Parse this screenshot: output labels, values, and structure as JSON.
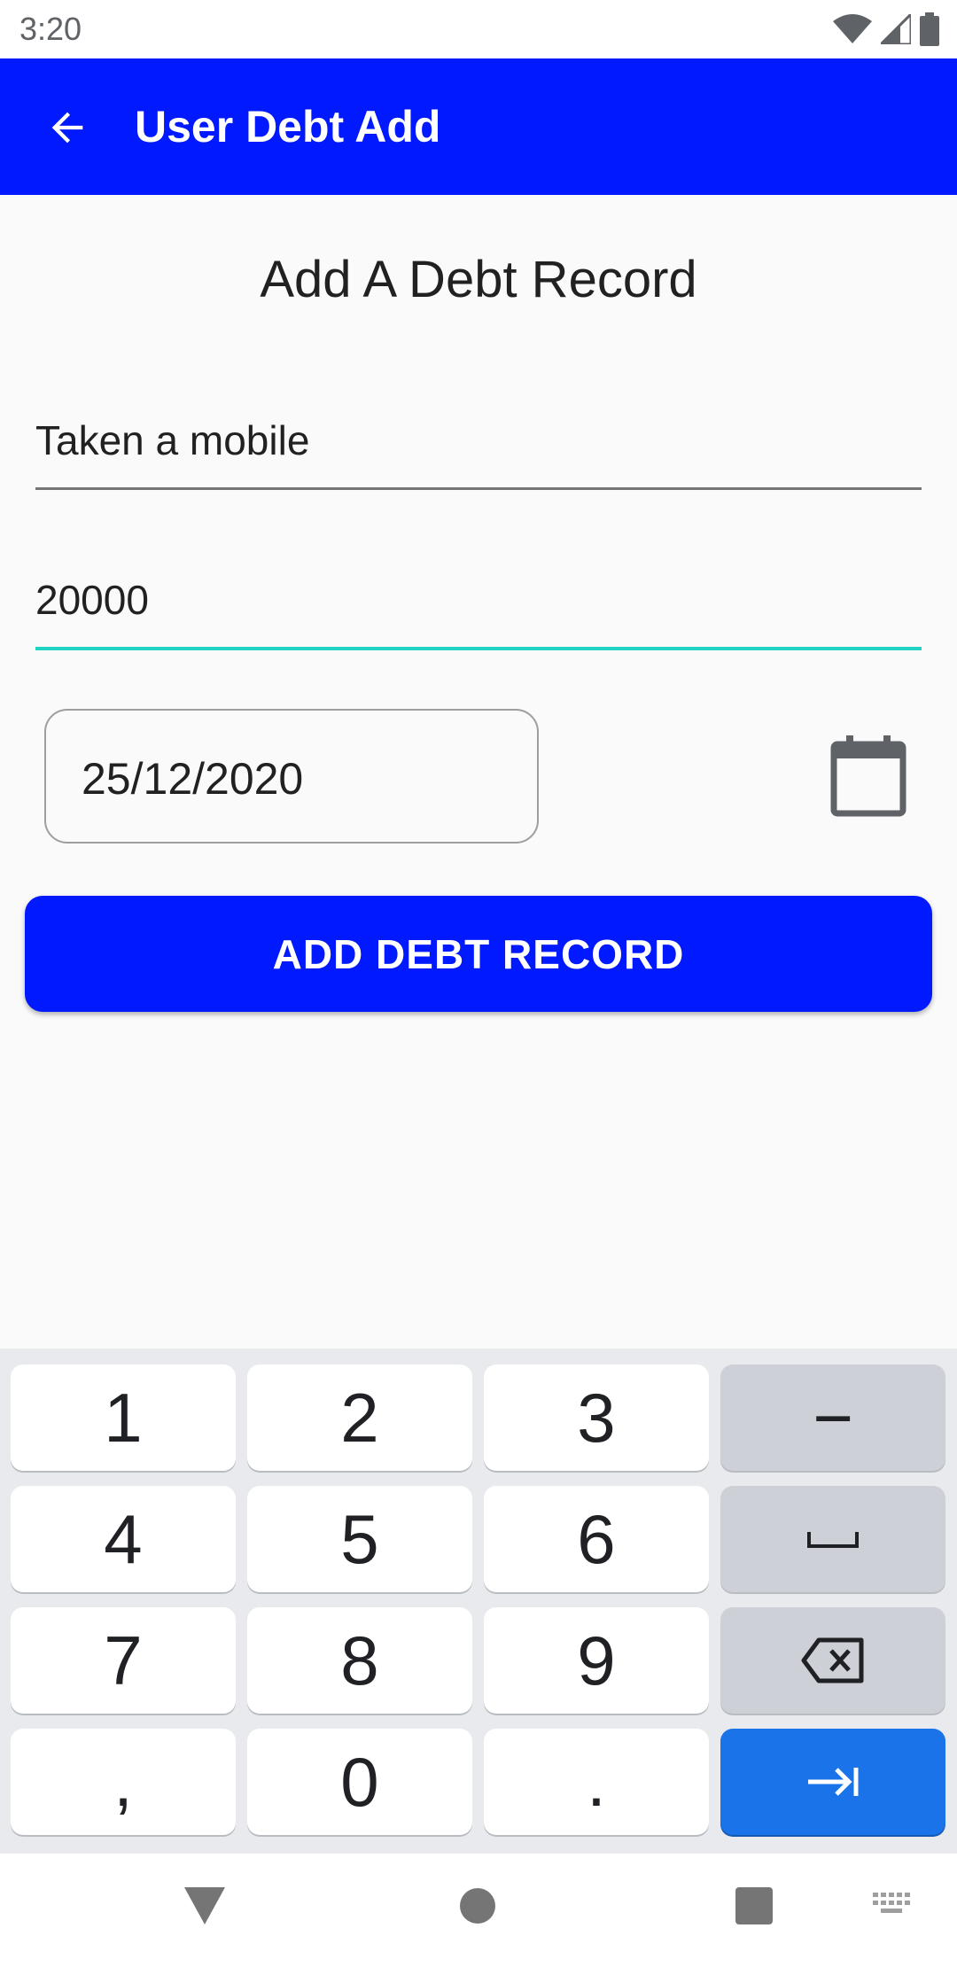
{
  "status_bar": {
    "time": "3:20"
  },
  "app_bar": {
    "title": "User Debt Add"
  },
  "form": {
    "heading": "Add A Debt Record",
    "description_value": "Taken a mobile",
    "amount_value": "20000",
    "date_value": "25/12/2020",
    "submit_label": "ADD DEBT RECORD"
  },
  "keyboard": {
    "keys": [
      "1",
      "2",
      "3",
      "−",
      "4",
      "5",
      "6",
      "7",
      "8",
      "9",
      ",",
      "0",
      "."
    ],
    "key_names": [
      "space-key",
      "backspace-icon",
      "next-icon"
    ]
  },
  "colors": {
    "app_bar": "#0019ff",
    "primary_button": "#0019ff",
    "focus_underline": "#1fd2c2",
    "keyboard_enter": "#1a73e8"
  }
}
